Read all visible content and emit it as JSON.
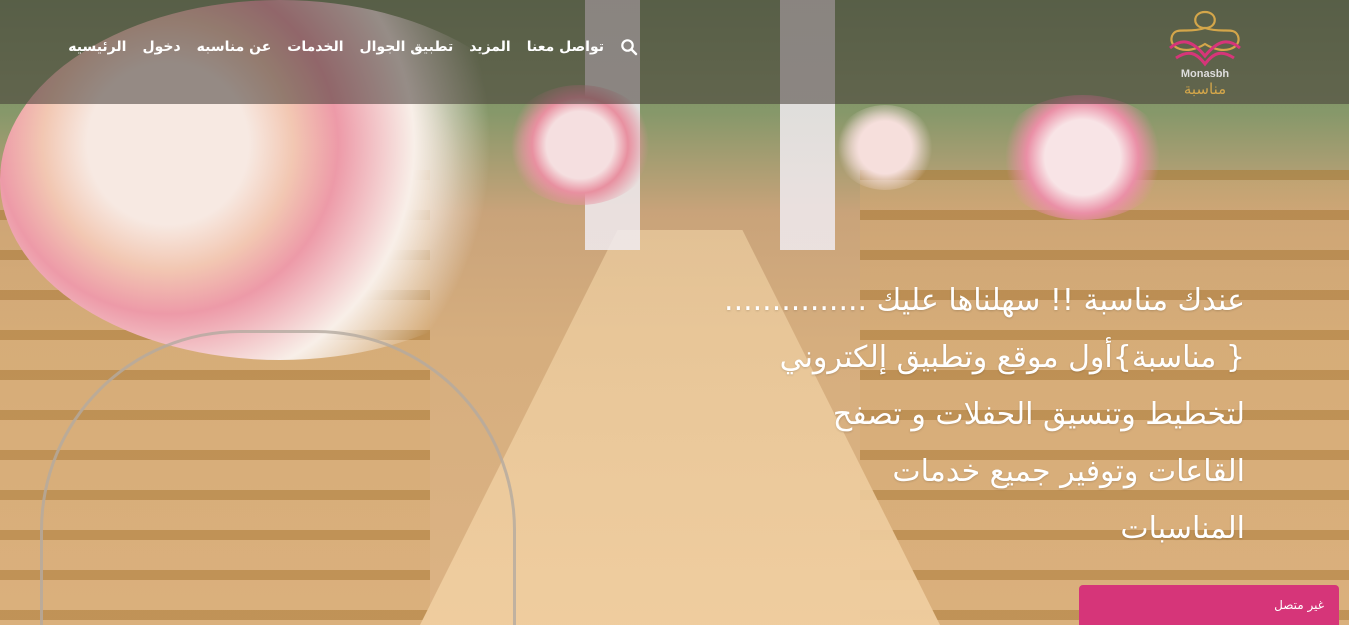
{
  "brand": {
    "name_latin": "Monasbh",
    "name_arabic": "مناسبة",
    "logo_colors": {
      "primary": "#d4a64a",
      "accent": "#d63579"
    }
  },
  "nav": {
    "items": [
      {
        "label": "الرئيسيه"
      },
      {
        "label": "دخول"
      },
      {
        "label": "عن مناسبه"
      },
      {
        "label": "الخدمات"
      },
      {
        "label": "تطبيق الجوال"
      },
      {
        "label": "المزيد"
      },
      {
        "label": "تواصل معنا"
      }
    ],
    "search_icon": "search-icon"
  },
  "hero": {
    "lines": [
      "عندك مناسبة !! سهلناها عليك ...............",
      "{ مناسبة}أول موقع وتطبيق إلكتروني",
      "لتخطيط وتنسيق الحفلات و تصفح",
      "القاعات وتوفير جميع خدمات",
      "المناسبات"
    ]
  },
  "status": {
    "label": "غير متصل",
    "color": "#d63579"
  }
}
